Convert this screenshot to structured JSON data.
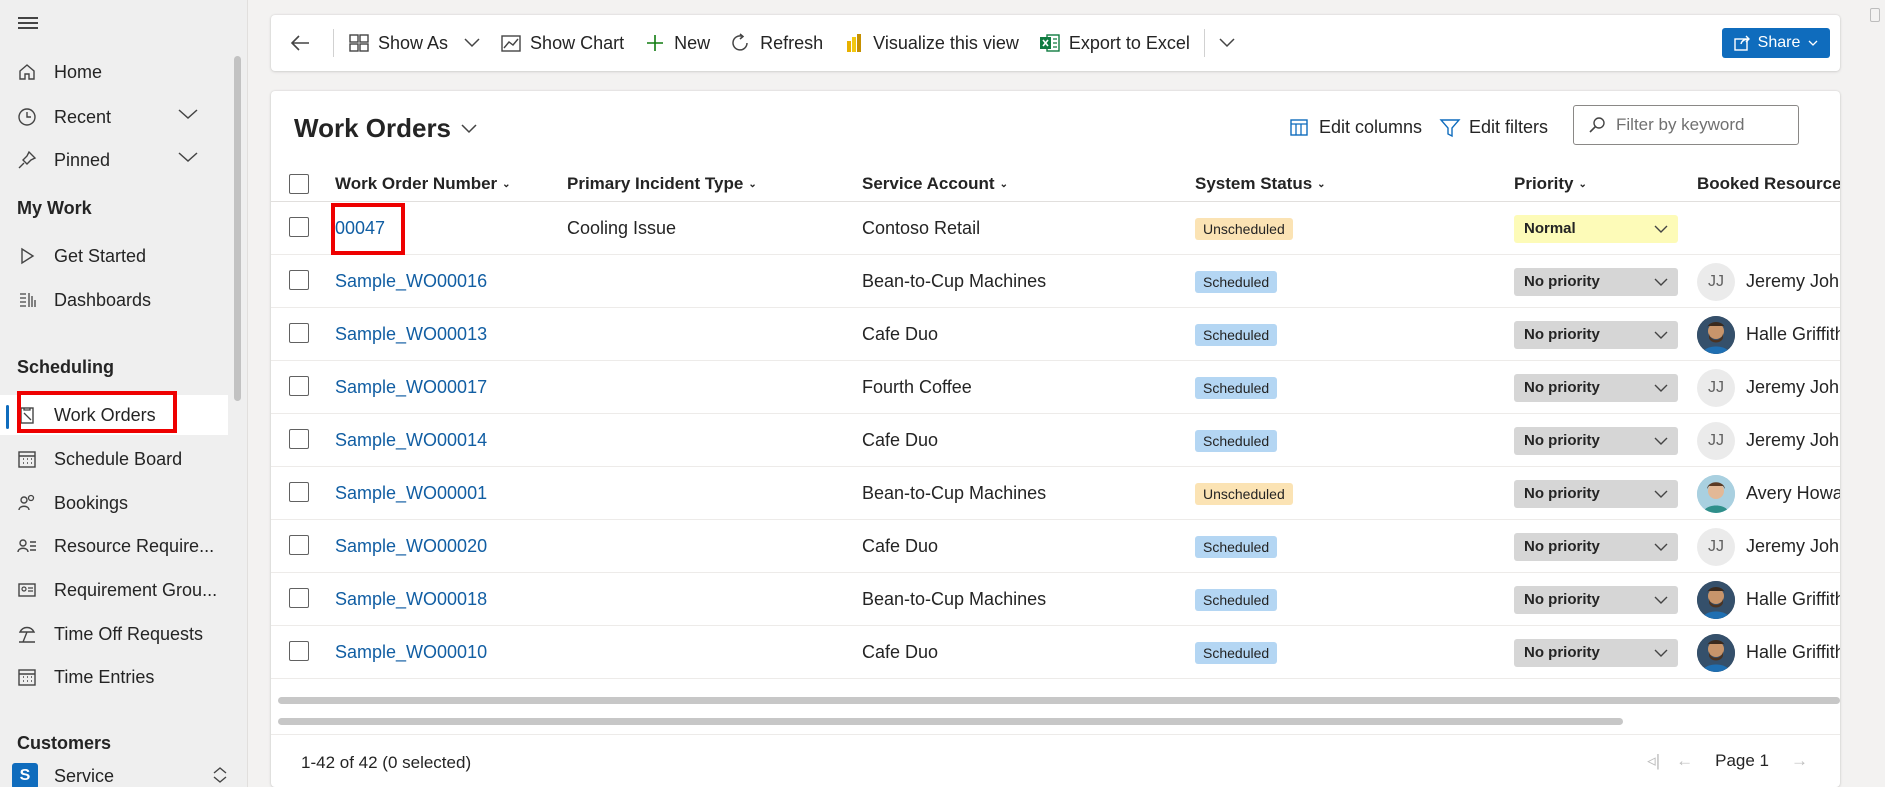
{
  "sidebar": {
    "items_top": [
      {
        "label": "Home",
        "icon": "home-icon"
      },
      {
        "label": "Recent",
        "icon": "clock-icon"
      },
      {
        "label": "Pinned",
        "icon": "pin-icon"
      }
    ],
    "my_work_header": "My Work",
    "my_work": [
      {
        "label": "Get Started",
        "icon": "play-icon"
      },
      {
        "label": "Dashboards",
        "icon": "dashboard-icon"
      }
    ],
    "scheduling_header": "Scheduling",
    "scheduling": [
      {
        "label": "Work Orders",
        "icon": "clipboard-icon"
      },
      {
        "label": "Schedule Board",
        "icon": "calendar-icon"
      },
      {
        "label": "Bookings",
        "icon": "people-icon"
      },
      {
        "label": "Resource Require...",
        "icon": "person-list-icon"
      },
      {
        "label": "Requirement Grou...",
        "icon": "contact-card-icon"
      },
      {
        "label": "Time Off Requests",
        "icon": "beach-icon"
      },
      {
        "label": "Time Entries",
        "icon": "calendar-icon"
      }
    ],
    "customers_header": "Customers",
    "area": {
      "tile": "S",
      "label": "Service"
    }
  },
  "command_bar": {
    "show_as": "Show As",
    "show_chart": "Show Chart",
    "new": "New",
    "refresh": "Refresh",
    "visualize": "Visualize this view",
    "export": "Export to Excel",
    "share": "Share"
  },
  "view": {
    "title": "Work Orders",
    "edit_columns": "Edit columns",
    "edit_filters": "Edit filters",
    "filter_placeholder": "Filter by keyword"
  },
  "columns": [
    "Work Order Number",
    "Primary Incident Type",
    "Service Account",
    "System Status",
    "Priority",
    "Booked Resources"
  ],
  "rows": [
    {
      "number": "00047",
      "incident": "Cooling Issue",
      "account": "Contoso Retail",
      "status": "Unscheduled",
      "priority": "Normal",
      "resource": "",
      "avatar": ""
    },
    {
      "number": "Sample_WO00016",
      "incident": "",
      "account": "Bean-to-Cup Machines",
      "status": "Scheduled",
      "priority": "No priority",
      "resource": "Jeremy John",
      "avatar": "JJ"
    },
    {
      "number": "Sample_WO00013",
      "incident": "",
      "account": "Cafe Duo",
      "status": "Scheduled",
      "priority": "No priority",
      "resource": "Halle Griffith",
      "avatar": "photo"
    },
    {
      "number": "Sample_WO00017",
      "incident": "",
      "account": "Fourth Coffee",
      "status": "Scheduled",
      "priority": "No priority",
      "resource": "Jeremy John",
      "avatar": "JJ"
    },
    {
      "number": "Sample_WO00014",
      "incident": "",
      "account": "Cafe Duo",
      "status": "Scheduled",
      "priority": "No priority",
      "resource": "Jeremy John",
      "avatar": "JJ"
    },
    {
      "number": "Sample_WO00001",
      "incident": "",
      "account": "Bean-to-Cup Machines",
      "status": "Unscheduled",
      "priority": "No priority",
      "resource": "Avery Howa",
      "avatar": "photo2"
    },
    {
      "number": "Sample_WO00020",
      "incident": "",
      "account": "Cafe Duo",
      "status": "Scheduled",
      "priority": "No priority",
      "resource": "Jeremy John",
      "avatar": "JJ"
    },
    {
      "number": "Sample_WO00018",
      "incident": "",
      "account": "Bean-to-Cup Machines",
      "status": "Scheduled",
      "priority": "No priority",
      "resource": "Halle Griffith",
      "avatar": "photo"
    },
    {
      "number": "Sample_WO00010",
      "incident": "",
      "account": "Cafe Duo",
      "status": "Scheduled",
      "priority": "No priority",
      "resource": "Halle Griffith",
      "avatar": "photo"
    }
  ],
  "footer": {
    "count": "1-42 of 42 (0 selected)",
    "page": "Page 1"
  },
  "colors": {
    "accent": "#0f6cbd",
    "scheduled": "#b4d6f3",
    "unscheduled": "#fbe3b4",
    "normal_priority": "#fdfbb8",
    "no_priority": "#d6d6d6",
    "highlight": "#ee0000"
  }
}
